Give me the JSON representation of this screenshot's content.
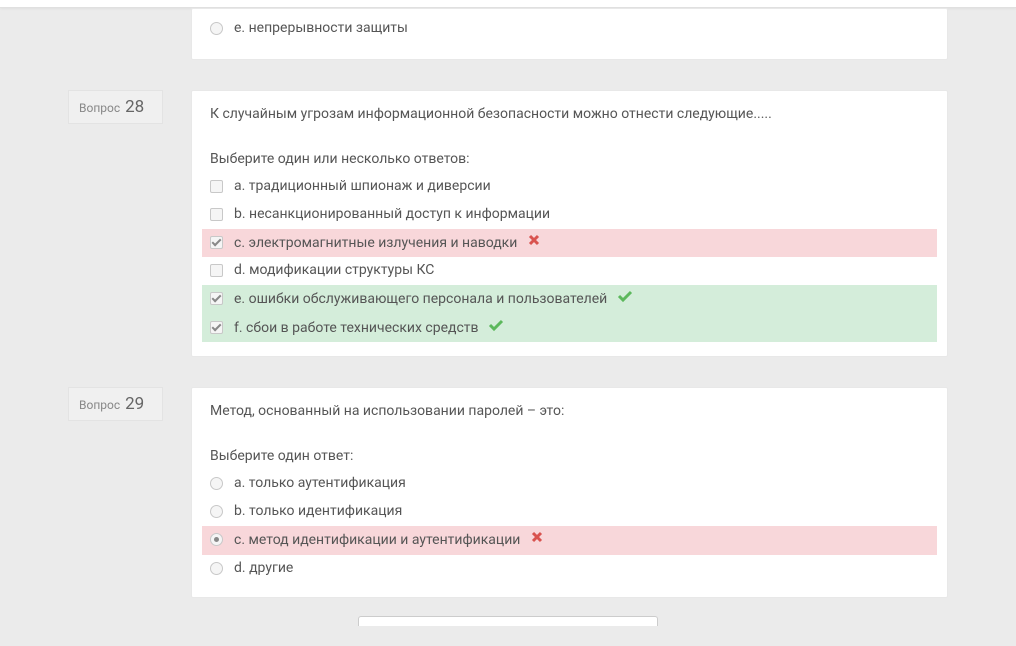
{
  "fragment_top": {
    "option": {
      "letter": "e.",
      "text": "непрерывности защиты"
    }
  },
  "questions": [
    {
      "label_word": "Вопрос",
      "number": "28",
      "text": "К случайным угрозам информационной безопасности можно отнести следующие.....",
      "prompt": "Выберите один или несколько ответов:",
      "type": "checkbox",
      "options": [
        {
          "letter": "a.",
          "text": "традиционный шпионаж и диверсии",
          "selected": false,
          "status": "none"
        },
        {
          "letter": "b.",
          "text": "несанкционированный доступ к информации",
          "selected": false,
          "status": "none"
        },
        {
          "letter": "c.",
          "text": "электромагнитные излучения и наводки",
          "selected": true,
          "status": "incorrect"
        },
        {
          "letter": "d.",
          "text": "модификации структуры КС",
          "selected": false,
          "status": "none"
        },
        {
          "letter": "e.",
          "text": "ошибки обслуживающего персонала и пользователей",
          "selected": true,
          "status": "correct"
        },
        {
          "letter": "f.",
          "text": "сбои в работе технических средств",
          "selected": true,
          "status": "correct"
        }
      ]
    },
    {
      "label_word": "Вопрос",
      "number": "29",
      "text": "Метод, основанный на использовании паролей – это:",
      "prompt": "Выберите один ответ:",
      "type": "radio",
      "options": [
        {
          "letter": "a.",
          "text": "только аутентификация",
          "selected": false,
          "status": "none"
        },
        {
          "letter": "b.",
          "text": "только идентификация",
          "selected": false,
          "status": "none"
        },
        {
          "letter": "c.",
          "text": "метод идентификации и аутентификации",
          "selected": true,
          "status": "incorrect"
        },
        {
          "letter": "d.",
          "text": "другие",
          "selected": false,
          "status": "none"
        }
      ]
    }
  ]
}
